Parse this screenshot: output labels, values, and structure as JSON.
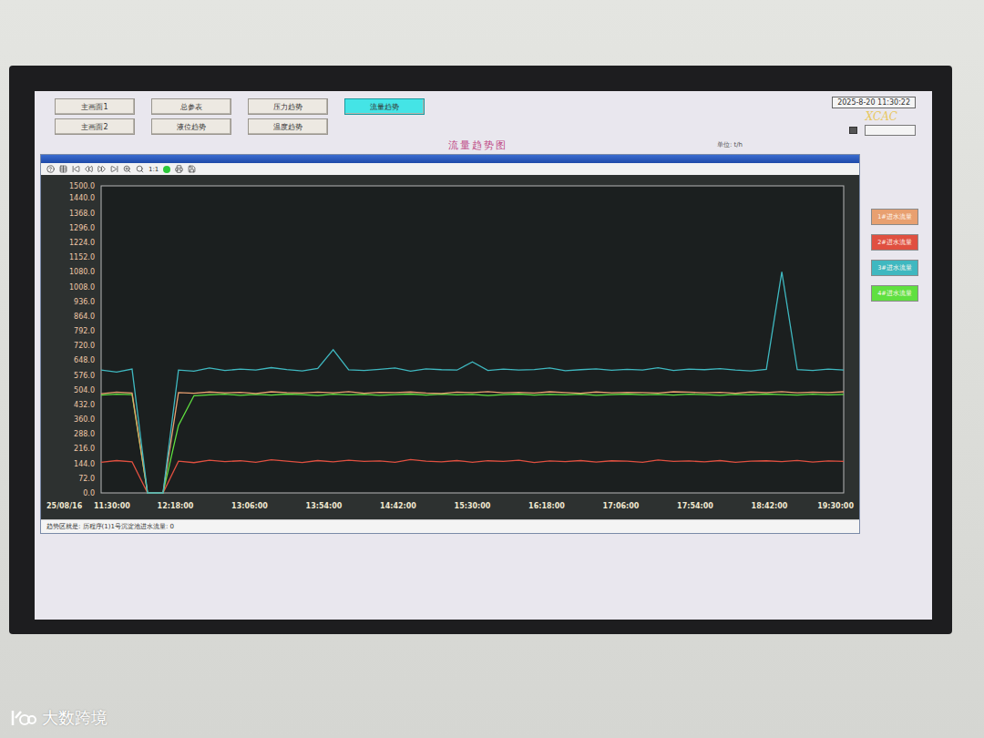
{
  "window": {
    "title": "流量趋势图",
    "unit": "单位: t/h",
    "datetime": "2025-8-20 11:30:22",
    "logo": "XCAC"
  },
  "nav": [
    {
      "label": "主画面1",
      "selected": false
    },
    {
      "label": "总参表",
      "selected": false
    },
    {
      "label": "压力趋势",
      "selected": false
    },
    {
      "label": "流量趋势",
      "selected": true
    },
    {
      "label": "主画面2",
      "selected": false
    },
    {
      "label": "液位趋势",
      "selected": false
    },
    {
      "label": "温度趋势",
      "selected": false
    }
  ],
  "toolbar": {
    "zoom_label": "1:1"
  },
  "chart": {
    "y_ticks": [
      "1500.0",
      "1440.0",
      "1368.0",
      "1296.0",
      "1224.0",
      "1152.0",
      "1080.0",
      "1008.0",
      "936.0",
      "864.0",
      "792.0",
      "720.0",
      "648.0",
      "576.0",
      "504.0",
      "432.0",
      "360.0",
      "288.0",
      "216.0",
      "144.0",
      "72.0",
      "0.0"
    ],
    "date": "25/08/16",
    "x_ticks": [
      "11:30:00",
      "12:18:00",
      "13:06:00",
      "13:54:00",
      "14:42:00",
      "15:30:00",
      "16:18:00",
      "17:06:00",
      "17:54:00",
      "18:42:00",
      "19:30:00"
    ],
    "series": [
      {
        "name": "1#进水流量",
        "color": "#e8a070",
        "values": [
          485,
          492,
          488,
          0,
          0,
          490,
          487,
          493,
          489,
          491,
          486,
          494,
          490,
          488,
          492,
          489,
          495,
          487,
          491,
          490,
          493,
          488,
          486,
          492,
          490,
          495,
          489,
          491,
          488,
          494,
          490,
          487,
          493,
          489,
          491,
          490,
          488,
          494,
          492,
          489,
          491,
          487,
          493,
          490,
          495,
          489,
          492,
          490,
          494
        ]
      },
      {
        "name": "2#进水流量",
        "color": "#e05040",
        "values": [
          150,
          158,
          152,
          0,
          0,
          155,
          148,
          160,
          153,
          157,
          150,
          162,
          155,
          149,
          158,
          152,
          160,
          154,
          156,
          150,
          163,
          155,
          152,
          158,
          150,
          157,
          154,
          160,
          149,
          156,
          153,
          158,
          151,
          157,
          155,
          150,
          161,
          154,
          156,
          152,
          158,
          150,
          155,
          157,
          153,
          159,
          151,
          156,
          154
        ]
      },
      {
        "name": "3#进水流量",
        "color": "#3fb8c0",
        "values": [
          600,
          590,
          605,
          0,
          0,
          600,
          595,
          610,
          598,
          605,
          600,
          612,
          603,
          596,
          608,
          700,
          601,
          598,
          604,
          610,
          595,
          606,
          602,
          600,
          640,
          598,
          605,
          600,
          603,
          610,
          597,
          602,
          606,
          599,
          604,
          600,
          611,
          598,
          605,
          602,
          607,
          600,
          596,
          604,
          1080,
          602,
          598,
          605,
          600
        ]
      },
      {
        "name": "4#进水流量",
        "color": "#60e040",
        "values": [
          478,
          482,
          480,
          0,
          0,
          330,
          475,
          479,
          482,
          477,
          481,
          478,
          483,
          480,
          476,
          482,
          479,
          481,
          477,
          480,
          483,
          478,
          482,
          479,
          481,
          476,
          480,
          483,
          478,
          481,
          479,
          482,
          477,
          480,
          483,
          479,
          481,
          478,
          482,
          480,
          477,
          481,
          479,
          483,
          480,
          478,
          482,
          479,
          481
        ]
      }
    ],
    "status": "趋势区就是: 历程序(1)1号沉淀池进水流量: 0"
  },
  "watermark": {
    "text": "大数跨境"
  }
}
